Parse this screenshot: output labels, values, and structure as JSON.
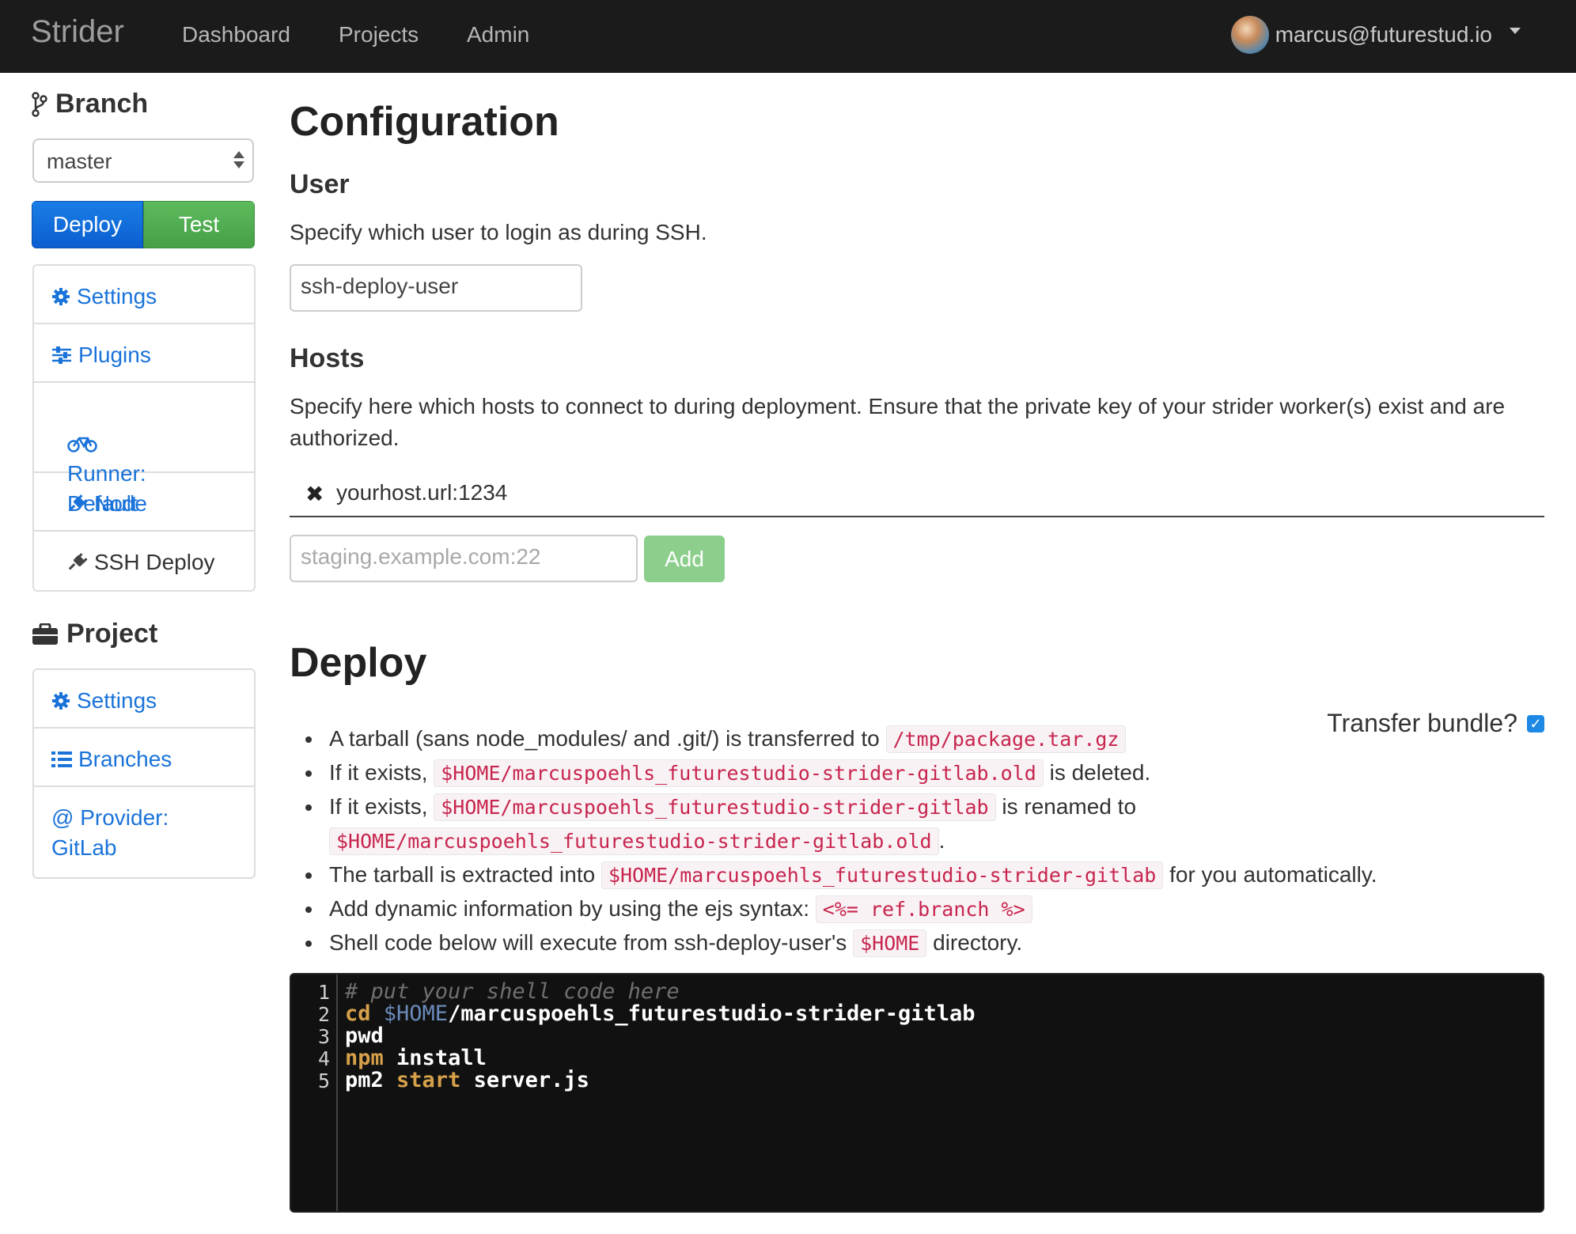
{
  "navbar": {
    "brand": "Strider",
    "links": [
      "Dashboard",
      "Projects",
      "Admin"
    ],
    "user_email": "marcus@futurestud.io"
  },
  "sidebar": {
    "branch_heading": "Branch",
    "branch_select_value": "master",
    "deploy_button": "Deploy",
    "test_button": "Test",
    "branch_items": [
      {
        "label": "Settings",
        "icon": "gear-icon"
      },
      {
        "label": "Plugins",
        "icon": "sliders-icon"
      },
      {
        "label": "Runner:\nDefault",
        "icon": "bicycle-icon"
      },
      {
        "label": "Node",
        "icon": "plug-icon"
      },
      {
        "label": "SSH Deploy",
        "icon": "plug-icon"
      }
    ],
    "project_heading": "Project",
    "project_items": [
      {
        "label": "Settings",
        "icon": "gear-icon"
      },
      {
        "label": "Branches",
        "icon": "list-icon"
      },
      {
        "label": "@ Provider:\nGitLab",
        "icon": ""
      }
    ]
  },
  "main": {
    "title": "Configuration",
    "user_section": {
      "heading": "User",
      "description": "Specify which user to login as during SSH.",
      "input_value": "ssh-deploy-user"
    },
    "hosts_section": {
      "heading": "Hosts",
      "description": "Specify here which hosts to connect to during deployment. Ensure that the private key of your strider worker(s) exist and are authorized.",
      "hosts": [
        "yourhost.url:1234"
      ],
      "new_host_placeholder": "staging.example.com:22",
      "add_button": "Add"
    },
    "deploy_section": {
      "heading": "Deploy",
      "transfer_label": "Transfer bundle?",
      "transfer_checked": true,
      "bullets": [
        {
          "pre": "A tarball (sans node_modules/ and .git/) is transferred to ",
          "code": "/tmp/package.tar.gz",
          "post": ""
        },
        {
          "pre": "If it exists, ",
          "code": "$HOME/marcuspoehls_futurestudio-strider-gitlab.old",
          "post": " is deleted."
        },
        {
          "pre": "If it exists, ",
          "code": "$HOME/marcuspoehls_futurestudio-strider-gitlab",
          "post": " is renamed to ",
          "code2": "$HOME/marcuspoehls_futurestudio-strider-gitlab.old",
          "post2": "."
        },
        {
          "pre": "The tarball is extracted into ",
          "code": "$HOME/marcuspoehls_futurestudio-strider-gitlab",
          "post": " for you automatically."
        },
        {
          "pre": "Add dynamic information by using the ejs syntax: ",
          "code": "<%= ref.branch %>",
          "post": ""
        },
        {
          "pre": "Shell code below will execute from ssh-deploy-user's ",
          "code": "$HOME",
          "post": " directory."
        }
      ],
      "editor_lines": [
        {
          "num": "1",
          "text": "# put your shell code here"
        },
        {
          "num": "2",
          "text": "cd $HOME/marcuspoehls_futurestudio-strider-gitlab"
        },
        {
          "num": "3",
          "text": "pwd"
        },
        {
          "num": "4",
          "text": "npm install"
        },
        {
          "num": "5",
          "text": "pm2 start server.js"
        }
      ]
    }
  },
  "colors": {
    "navbar_bg": "#1b1b1b",
    "link_blue": "#1a73d9",
    "deploy_blue": "#0b5ed0",
    "test_green": "#46a046",
    "code_red": "#c7254e"
  }
}
